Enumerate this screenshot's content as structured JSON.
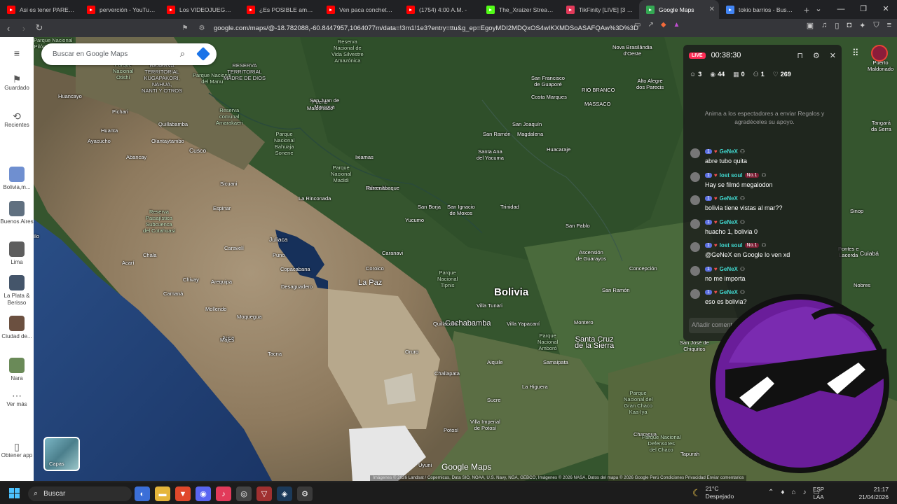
{
  "browser": {
    "tabs": [
      {
        "title": "Asi es tener PAREJA en",
        "icon": "youtube-icon",
        "color": "#ff0000"
      },
      {
        "title": "perverción - YouTube",
        "icon": "youtube-icon",
        "color": "#ff0000"
      },
      {
        "title": "Los VIDEOJUEGOS FLA",
        "icon": "youtube-icon",
        "color": "#ff0000"
      },
      {
        "title": "¿Es POSIBLE amar en la",
        "icon": "youtube-icon",
        "color": "#ff0000"
      },
      {
        "title": "Ven paca conchetumar",
        "icon": "youtube-icon",
        "color": "#ff0000"
      },
      {
        "title": "(1754) 4:00 A.M. -",
        "icon": "youtube-icon",
        "color": "#ff0000"
      },
      {
        "title": "The_Xraizer Stream - K",
        "icon": "kick-icon",
        "color": "#53fc18"
      },
      {
        "title": "TikFinity [LIVE] [3 View",
        "icon": "tikfinity-icon",
        "color": "#e23a5a"
      },
      {
        "title": "Google Maps",
        "icon": "google-maps-icon",
        "color": "#34a853",
        "active": true
      },
      {
        "title": "tokio barrios - Buscar c",
        "icon": "google-icon",
        "color": "#4285f4"
      }
    ],
    "url": "google.com/maps/@-18.782088,-60.8447957,1064077m/data=!3m1!1e3?entry=ttu&g_ep=EgoyMDI2MDQxOS4wIKXMDSoASAFQAw%3D%3D"
  },
  "maps": {
    "search_placeholder": "Buscar en Google Maps",
    "rail": {
      "saved": "Guardado",
      "recents": "Recientes",
      "recents_items": [
        {
          "label": "Bolivia,m...",
          "color": "#6f8fd0"
        },
        {
          "label": "Buenos Aires",
          "color": "#607080"
        },
        {
          "label": "Lima",
          "color": "#5e5e5e"
        },
        {
          "label": "La Plata & Berisso",
          "color": "#44556a"
        },
        {
          "label": "Ciudad de...",
          "color": "#6b5040"
        },
        {
          "label": "Nara",
          "color": "#6a8a58"
        }
      ],
      "more": "Ver más",
      "get_app": "Obtener app"
    },
    "layers_label": "Capas",
    "watermark": "Google Maps",
    "attribution": "Imágenes © 2026 Landsat / Copernicus, Data SIO, NOAA, U.S. Navy, NGA, GEBCO, Imágenes © 2026 NASA, Datos del mapa © 2026 Google     Perú     Condiciones     Privacidad     Enviar comentarios",
    "labels": [
      {
        "text": "Bolivia",
        "cls": "country"
      },
      {
        "text": "La Paz",
        "cls": "big"
      },
      {
        "text": "Cochabamba",
        "cls": "big"
      },
      {
        "text": "Santa Cruz\nde la Sierra",
        "cls": "big"
      },
      {
        "text": "Cusco",
        "cls": "city"
      },
      {
        "text": "Juliaca",
        "cls": "city"
      },
      {
        "text": "Puno",
        "cls": ""
      },
      {
        "text": "Arequipa",
        "cls": ""
      },
      {
        "text": "Copacabana",
        "cls": ""
      },
      {
        "text": "Desaguadero",
        "cls": ""
      },
      {
        "text": "Oruro",
        "cls": ""
      },
      {
        "text": "Sucre",
        "cls": ""
      },
      {
        "text": "Potosí",
        "cls": ""
      },
      {
        "text": "Trinidad",
        "cls": ""
      },
      {
        "text": "San Borja",
        "cls": ""
      },
      {
        "text": "Riberalta",
        "cls": ""
      },
      {
        "text": "Puerto\nMaldonado",
        "cls": ""
      },
      {
        "text": "Huancayo",
        "cls": ""
      },
      {
        "text": "Ayacucho",
        "cls": ""
      },
      {
        "text": "Quillabamba",
        "cls": ""
      },
      {
        "text": "Sicuani",
        "cls": ""
      },
      {
        "text": "Espinar",
        "cls": ""
      },
      {
        "text": "Moquegua",
        "cls": ""
      },
      {
        "text": "Tacna",
        "cls": ""
      },
      {
        "text": "Arica",
        "cls": ""
      },
      {
        "text": "Camaná",
        "cls": ""
      },
      {
        "text": "Mollendo",
        "cls": ""
      },
      {
        "text": "San Ramón",
        "cls": ""
      },
      {
        "text": "Magdalena",
        "cls": ""
      },
      {
        "text": "Huacaraje",
        "cls": ""
      },
      {
        "text": "San Joaquín",
        "cls": ""
      },
      {
        "text": "Costa Marques",
        "cls": ""
      },
      {
        "text": "MASSACO",
        "cls": ""
      },
      {
        "text": "RIO BRANCO",
        "cls": ""
      },
      {
        "text": "Concepción",
        "cls": ""
      },
      {
        "text": "Ascensión\nde Guarayos",
        "cls": ""
      },
      {
        "text": "San Ramón",
        "cls": ""
      },
      {
        "text": "San Pablo",
        "cls": ""
      },
      {
        "text": "Montero",
        "cls": ""
      },
      {
        "text": "Samaipata",
        "cls": ""
      },
      {
        "text": "Aiquile",
        "cls": ""
      },
      {
        "text": "La Higuera",
        "cls": ""
      },
      {
        "text": "Villa Tunari",
        "cls": ""
      },
      {
        "text": "Villa Yapacaní",
        "cls": ""
      },
      {
        "text": "Quillacollo",
        "cls": ""
      },
      {
        "text": "Yucumo",
        "cls": ""
      },
      {
        "text": "Caranavi",
        "cls": ""
      },
      {
        "text": "Coroico",
        "cls": ""
      },
      {
        "text": "La Rinconada",
        "cls": ""
      },
      {
        "text": "Ixiamas",
        "cls": ""
      },
      {
        "text": "Rurrenabaque",
        "cls": ""
      },
      {
        "text": "San Ignacio\nde Moxos",
        "cls": ""
      },
      {
        "text": "Santa Ana\ndel Yacuma",
        "cls": ""
      },
      {
        "text": "Challapata",
        "cls": ""
      },
      {
        "text": "Uyuni",
        "cls": ""
      },
      {
        "text": "Charagua",
        "cls": ""
      },
      {
        "text": "Villa Imperial\nde Potosí",
        "cls": ""
      },
      {
        "text": "Parque\nNacional\nMadidi",
        "cls": "park"
      },
      {
        "text": "Parque\nNacional\nBahuaja\nSonene",
        "cls": "park"
      },
      {
        "text": "Reserva\ncomunal\nAmarakaeri",
        "cls": "park"
      },
      {
        "text": "Parque\nNacional\nTipnis",
        "cls": "park"
      },
      {
        "text": "Parque\nNacional\nAmboró",
        "cls": "park"
      },
      {
        "text": "Parque\nNacional del\nGran Chaco\nKaa-Iya",
        "cls": "park"
      },
      {
        "text": "Parque Nacional\ndel Manu",
        "cls": "park"
      },
      {
        "text": "Reserva\nPaisajística\nSubcuenca\ndel Cotahuasi",
        "cls": "park"
      },
      {
        "text": "Reserva\nNacional de\nVida Silvestre\nAmazónica",
        "cls": "park"
      },
      {
        "text": "RESERVA\nTERRITORIAL\nMADRE DE DIOS",
        "cls": "dim"
      },
      {
        "text": "RESERVA\nTERRITORIAL\nKUGAPAKORI,\nNAHUA,\nNANTI Y OTROS",
        "cls": "dim"
      },
      {
        "text": "San Francisco\nde Guaporé",
        "cls": ""
      },
      {
        "text": "Nova Brasilândia\nd'Oeste",
        "cls": ""
      },
      {
        "text": "Alto Alegre\ndos Parecis",
        "cls": ""
      },
      {
        "text": "Pontes e\nLacerda",
        "cls": ""
      },
      {
        "text": "Cuiabá",
        "cls": "city"
      },
      {
        "text": "Tangará\nda Serra",
        "cls": ""
      },
      {
        "text": "Sinop",
        "cls": ""
      },
      {
        "text": "Nobres",
        "cls": ""
      },
      {
        "text": "San José de\nChiquitos",
        "cls": ""
      },
      {
        "text": "Parque\nNacional\nOtishi",
        "cls": "park"
      },
      {
        "text": "Pichari",
        "cls": ""
      },
      {
        "text": "Huanta",
        "cls": ""
      },
      {
        "text": "Olantaytambo",
        "cls": ""
      },
      {
        "text": "Abancay",
        "cls": ""
      },
      {
        "text": "Acarí",
        "cls": ""
      },
      {
        "text": "Chala",
        "cls": ""
      },
      {
        "text": "Caravelí",
        "cls": ""
      },
      {
        "text": "Chivay",
        "cls": ""
      },
      {
        "text": "Majes",
        "cls": ""
      },
      {
        "text": "Ilo",
        "cls": ""
      },
      {
        "text": "San Juan de\nMarcona",
        "cls": ""
      },
      {
        "text": "Puerto\nMaldonado",
        "cls": ""
      },
      {
        "text": "Tapurah",
        "cls": ""
      },
      {
        "text": "Parque Nacional\nDefensores\ndel Chaco",
        "cls": "park"
      },
      {
        "text": "Parque Nacional\nPilón Lagerenza",
        "cls": "park"
      }
    ]
  },
  "tiktok_live": {
    "badge": "LIVE",
    "timer": "00:38:30",
    "stats": {
      "viewers_icon": "people-icon",
      "viewers": "3",
      "views": "44",
      "gifts": "0",
      "followers": "1",
      "likes": "269"
    },
    "hint": "Anima a los espectadores a enviar Regalos y agradéceles su apoyo.",
    "messages": [
      {
        "user": "GeNeX",
        "level": "1",
        "text": "abre tubo quita",
        "no1": ""
      },
      {
        "user": "lost soul",
        "level": "1",
        "text": "Hay se filmó megalodon",
        "no1": "No.1"
      },
      {
        "user": "GeNeX",
        "level": "1",
        "text": "bolivia tiene vistas al mar??",
        "no1": ""
      },
      {
        "user": "GeNeX",
        "level": "1",
        "text": "huacho 1, bolivia 0",
        "no1": ""
      },
      {
        "user": "lost soul",
        "level": "1",
        "text": "@GeNeX en Google lo ven xd",
        "no1": "No.1"
      },
      {
        "user": "GeNeX",
        "level": "1",
        "text": "no me importa",
        "no1": ""
      },
      {
        "user": "GeNeX",
        "level": "1",
        "text": "eso es bolivia?",
        "no1": ""
      }
    ],
    "input_placeholder": "Añadir comentario..."
  },
  "taskbar": {
    "search": "Buscar",
    "apps": [
      {
        "name": "copilot-icon",
        "glyph": "◐",
        "color": "#3b6fd8"
      },
      {
        "name": "file-explorer-icon",
        "glyph": "▬",
        "color": "#e5b53a"
      },
      {
        "name": "brave-icon",
        "glyph": "▼",
        "color": "#e0482b"
      },
      {
        "name": "discord-icon",
        "glyph": "◉",
        "color": "#5865f2"
      },
      {
        "name": "tiktok-icon",
        "glyph": "♪",
        "color": "#e23a5a"
      },
      {
        "name": "obs-icon",
        "glyph": "◎",
        "color": "#444444"
      },
      {
        "name": "vpn-icon",
        "glyph": "▽",
        "color": "#a03030"
      },
      {
        "name": "steam-icon",
        "glyph": "◈",
        "color": "#1b3a5a"
      },
      {
        "name": "settings-icon",
        "glyph": "⚙",
        "color": "#3a3a3a"
      }
    ],
    "weather_temp": "21°C",
    "weather_desc": "Despejado",
    "lang1": "ESP",
    "lang2": "LAA",
    "time": "21:17",
    "date": "21/04/2026"
  }
}
